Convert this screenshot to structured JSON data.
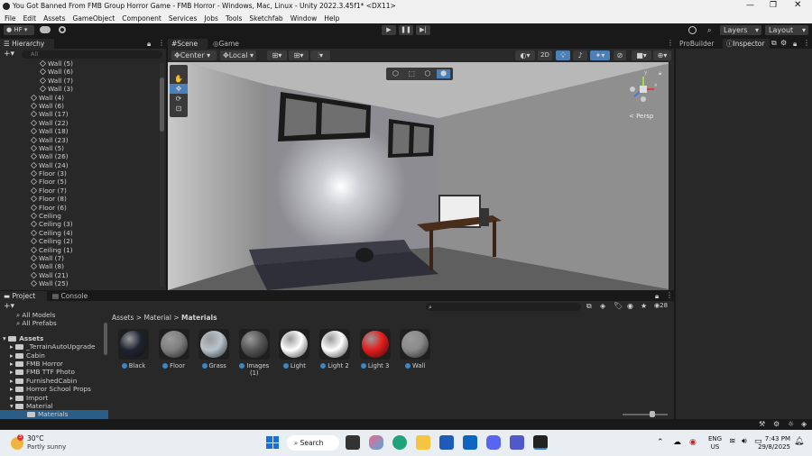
{
  "window": {
    "title": "You Got Banned From FMB Group Horror Game - FMB Horror - Windows, Mac, Linux - Unity 2022.3.45f1* <DX11>"
  },
  "menu": [
    "File",
    "Edit",
    "Assets",
    "GameObject",
    "Component",
    "Services",
    "Jobs",
    "Tools",
    "Sketchfab",
    "Window",
    "Help"
  ],
  "toolbar": {
    "account": "HF",
    "layers": "Layers",
    "layout": "Layout"
  },
  "hierarchy": {
    "tab": "Hierarchy",
    "search_placeholder": "All",
    "items": [
      {
        "label": "Wall (5)",
        "indent": 2
      },
      {
        "label": "Wall (6)",
        "indent": 2
      },
      {
        "label": "Wall (7)",
        "indent": 2
      },
      {
        "label": "Wall (3)",
        "indent": 2
      },
      {
        "label": "Wall (4)",
        "indent": 1
      },
      {
        "label": "Wall (6)",
        "indent": 1
      },
      {
        "label": "Wall (17)",
        "indent": 1
      },
      {
        "label": "Wall (22)",
        "indent": 1
      },
      {
        "label": "Wall (18)",
        "indent": 1
      },
      {
        "label": "Wall (23)",
        "indent": 1
      },
      {
        "label": "Wall (5)",
        "indent": 1
      },
      {
        "label": "Wall (26)",
        "indent": 1
      },
      {
        "label": "Wall (24)",
        "indent": 1
      },
      {
        "label": "Floor (3)",
        "indent": 1
      },
      {
        "label": "Floor (5)",
        "indent": 1
      },
      {
        "label": "Floor (7)",
        "indent": 1
      },
      {
        "label": "Floor (8)",
        "indent": 1
      },
      {
        "label": "Floor (6)",
        "indent": 1
      },
      {
        "label": "Ceiling",
        "indent": 1
      },
      {
        "label": "Ceiling (3)",
        "indent": 1
      },
      {
        "label": "Ceiling (4)",
        "indent": 1
      },
      {
        "label": "Ceiling (2)",
        "indent": 1
      },
      {
        "label": "Ceiling (1)",
        "indent": 1
      },
      {
        "label": "Wall (7)",
        "indent": 1
      },
      {
        "label": "Wall (8)",
        "indent": 1
      },
      {
        "label": "Wall (21)",
        "indent": 1
      },
      {
        "label": "Wall (25)",
        "indent": 1
      }
    ]
  },
  "scene": {
    "tabs": [
      "Scene",
      "Game"
    ],
    "pivot": "Center",
    "space": "Local",
    "mode_2d": "2D",
    "persp": "< Persp",
    "axis_y": "y",
    "axis_x": "x"
  },
  "right_panel": {
    "tabs": [
      "ProBuilder",
      "Inspector"
    ]
  },
  "project": {
    "tabs": [
      "Project",
      "Console"
    ],
    "favorites": [
      "All Models",
      "All Prefabs"
    ],
    "assets_root": "Assets",
    "folders": [
      "_TerrainAutoUpgrade",
      "Cabin",
      "FMB Horror",
      "FMB TTF Photo",
      "FurnishedCabin",
      "Horror School Props",
      "Import",
      "Material",
      "Materials"
    ],
    "breadcrumb": [
      "Assets",
      "Material",
      "Materials"
    ],
    "visible_count": "28",
    "materials": [
      {
        "name": "Black",
        "color": "#1e2430"
      },
      {
        "name": "Floor",
        "color": "#7f7f7f"
      },
      {
        "name": "Grass",
        "color": "#b9c4cc"
      },
      {
        "name": "Images (1)",
        "color": "#555555"
      },
      {
        "name": "Light",
        "color": "#ffffff"
      },
      {
        "name": "Light 2",
        "color": "#ffffff"
      },
      {
        "name": "Light 3",
        "color": "#e51b1b"
      },
      {
        "name": "Wall",
        "color": "#8a8a8a"
      }
    ]
  },
  "taskbar": {
    "temperature": "30°C",
    "weather": "Partly sunny",
    "weather_badge": "3",
    "search": "Search",
    "lang1": "ENG",
    "lang2": "US",
    "time": "7:43 PM",
    "date": "29/8/2025"
  }
}
